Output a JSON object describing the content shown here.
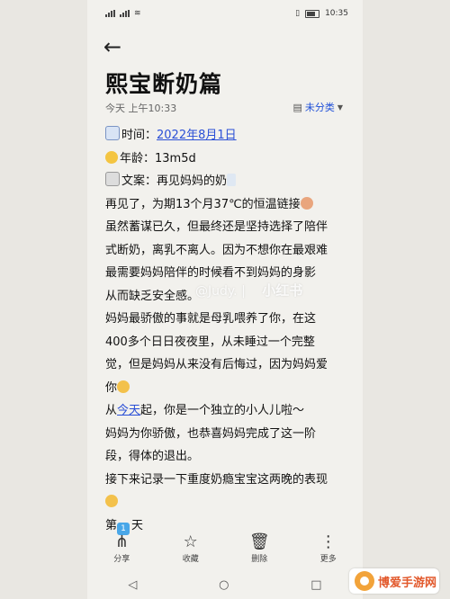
{
  "status": {
    "time": "10:35"
  },
  "note": {
    "title": "熙宝断奶篇",
    "meta": "今天 上午10:33",
    "category": "未分类"
  },
  "content": {
    "time_label": "时间：",
    "time_value": "2022年8月1日",
    "age_label": "年龄：",
    "age_value": "13m5d",
    "copy_label": "文案：",
    "copy_value": "再见妈妈的奶",
    "p1": [
      "再见了，为期13个月37℃的恒温链接",
      "虽然蓄谋已久，但最终还是坚持选择了陪伴",
      "式断奶，离乳不离人。因为不想你在最艰难",
      "最需要妈妈陪伴的时候看不到妈妈的身影",
      "从而缺乏安全感。"
    ],
    "p2": [
      "妈妈最骄傲的事就是母乳喂养了你，在这",
      "400多个日日夜夜里，从未睡过一个完整",
      "觉，但是妈妈从来没有后悔过，因为妈妈爱",
      "你"
    ],
    "p3_prefix": "从",
    "p3_link": "今天",
    "p3_rest": "起，你是一个独立的小人儿啦～",
    "p4": [
      "妈妈为你骄傲，也恭喜妈妈完成了这一阶",
      "段，得体的退出。"
    ],
    "p5": "接下来记录一下重度奶瘾宝宝这两晚的表现",
    "day_prefix": "第",
    "day_num": "1",
    "day_suffix": "天"
  },
  "watermark": {
    "handle": "@Judy.",
    "sep": "|",
    "brand": "小红书"
  },
  "toolbar": [
    {
      "label": "分享",
      "icon": "share-icon"
    },
    {
      "label": "收藏",
      "icon": "star-icon"
    },
    {
      "label": "删除",
      "icon": "trash-icon"
    },
    {
      "label": "更多",
      "icon": "more-icon"
    }
  ],
  "brand_badge": "博爱手游网"
}
